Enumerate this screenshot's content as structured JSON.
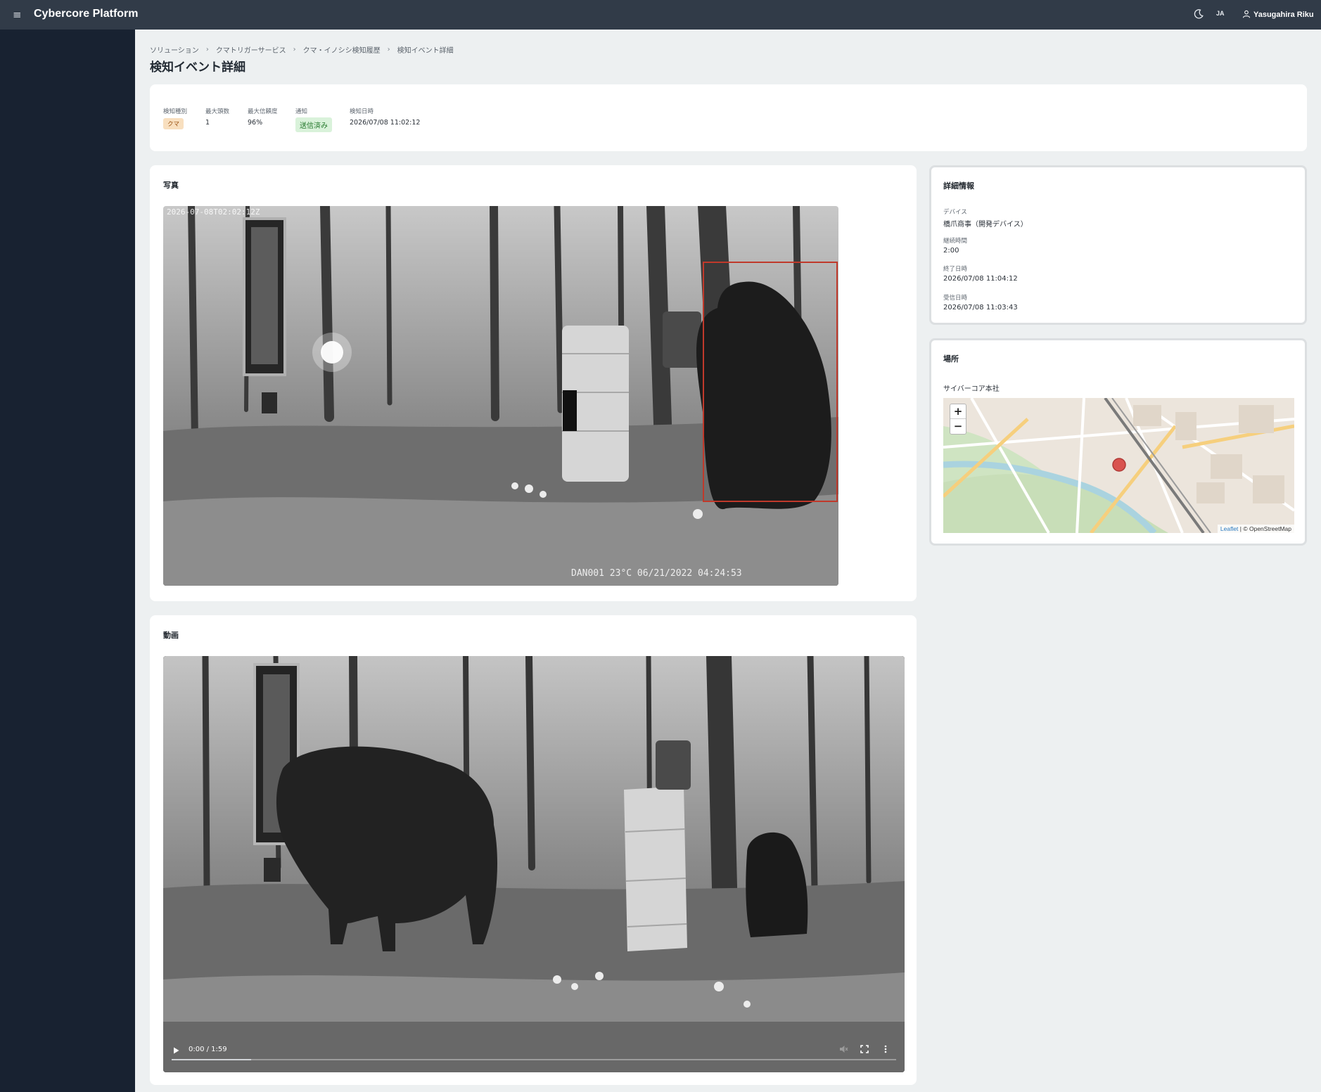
{
  "header": {
    "brand": "Cybercore Platform",
    "language": "JA",
    "user_name": "Yasugahira Riku",
    "icons": [
      "menu-icon",
      "moon-icon",
      "user-icon"
    ]
  },
  "breadcrumb": [
    "ソリューション",
    "クマトリガーサービス",
    "クマ・イノシシ検知履歴",
    "検知イベント詳細"
  ],
  "page_title": "検知イベント詳細",
  "summary": {
    "type_label": "検知種別",
    "type_value": "クマ",
    "max_count_label": "最大頭数",
    "max_count_value": "1",
    "max_confidence_label": "最大信頼度",
    "max_confidence_value": "96%",
    "notify_label": "通知",
    "notify_value": "送信済み",
    "detected_at_label": "検知日時",
    "detected_at_value": "2026/07/08 11:02:12"
  },
  "photo": {
    "title": "写真",
    "timestamp": "2026-07-08T02:02:12Z",
    "camera_overlay": "DAN001   23°C     06/21/2022  04:24:53"
  },
  "video": {
    "title": "動画",
    "time": "0:00 / 1:59",
    "progress": 0.11
  },
  "details": {
    "title": "詳細情報",
    "device_label": "デバイス",
    "device_value": "橋爪商事（開発デバイス）",
    "duration_label": "継続時間",
    "duration_value": "2:00",
    "end_label": "終了日時",
    "end_value": "2026/07/08 11:04:12",
    "received_label": "受信日時",
    "received_value": "2026/07/08 11:03:43"
  },
  "location": {
    "title": "場所",
    "place": "サイバーコア本社",
    "zoom_in": "+",
    "zoom_out": "−",
    "attribution_leaflet": "Leaflet",
    "attribution_osm": "| © OpenStreetMap"
  },
  "colors": {
    "topbar": "#313b48",
    "sidebar": "#182231",
    "page_bg": "#edf0f1",
    "badge_bear_bg": "#f8dfbf",
    "badge_sent_bg": "#d9f2da",
    "bbox": "#c0392b",
    "map_marker": "#d9534f"
  }
}
